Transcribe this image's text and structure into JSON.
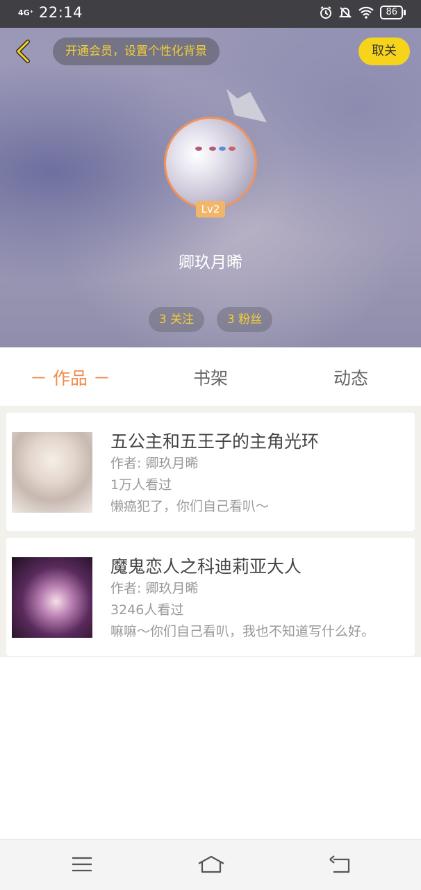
{
  "status_bar": {
    "signal": "4G⁺",
    "time": "22:14",
    "battery": "86"
  },
  "header": {
    "vip_promo": "开通会员，设置个性化背景",
    "unfollow_label": "取关",
    "level": "Lv2",
    "username": "卿玖月晞",
    "following": "3 关注",
    "fans": "3 粉丝"
  },
  "tabs": [
    "－ 作品 －",
    "书架",
    "动态"
  ],
  "works": [
    {
      "title": "五公主和五王子的主角光环",
      "author": "作者: 卿玖月晞",
      "views": "1万人看过",
      "desc": "懒癌犯了，你们自己看叭～"
    },
    {
      "title": "魔鬼恋人之科迪莉亚大人",
      "author": "作者: 卿玖月晞",
      "views": "3246人看过",
      "desc": "嘛嘛～你们自己看叭，我也不知道写什么好。"
    }
  ],
  "colors": {
    "accent": "#f08c4a",
    "vip_text": "#f4cf36",
    "unfollow_bg": "#f6d41c",
    "level_bg": "#f1b66a"
  }
}
